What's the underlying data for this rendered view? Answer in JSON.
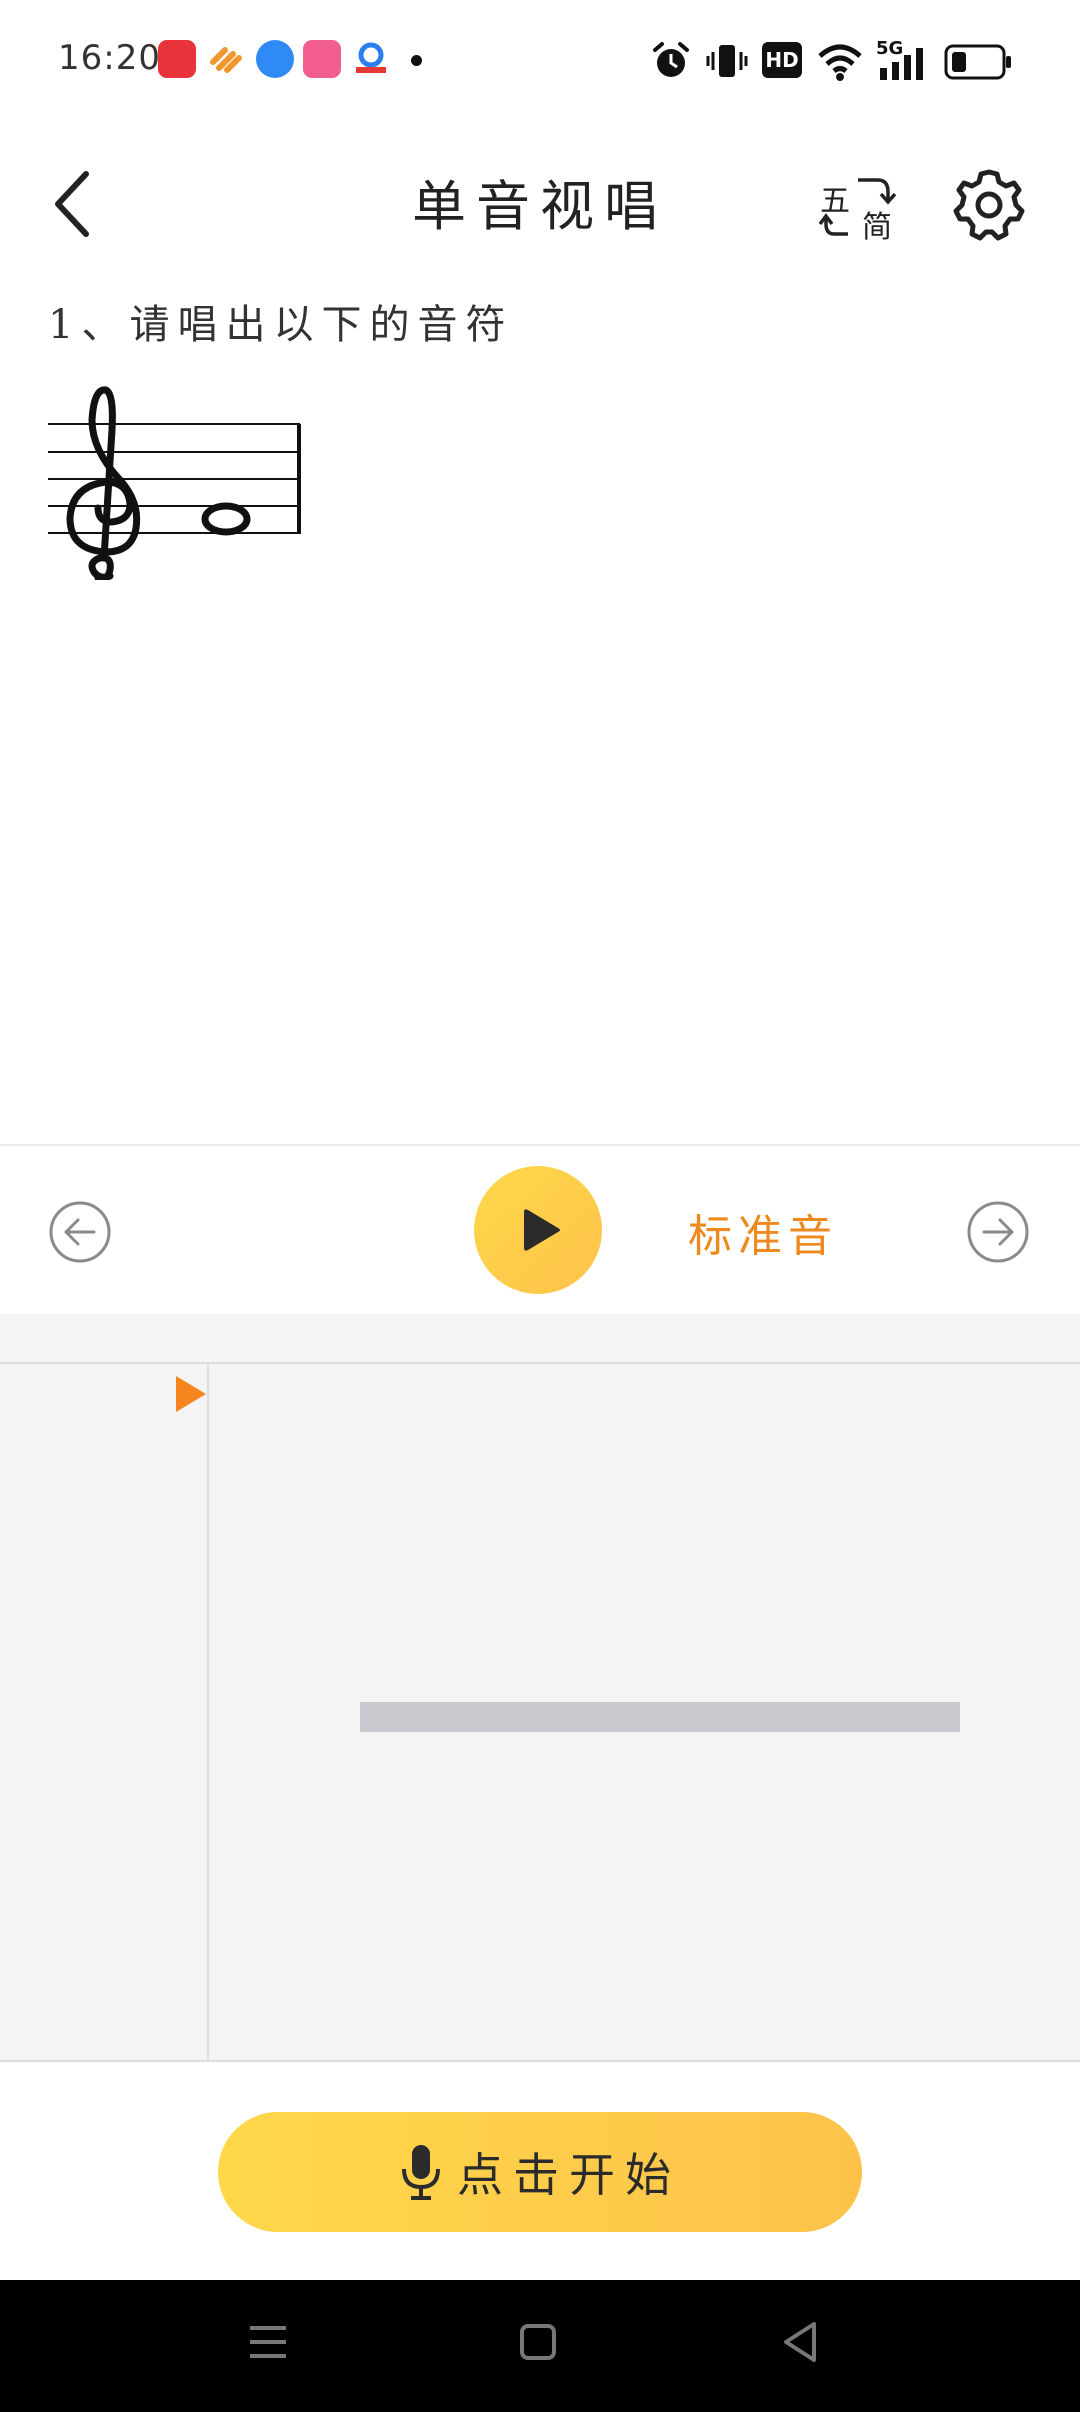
{
  "status_bar": {
    "time": "16:20",
    "network": "5G",
    "hd": "HD"
  },
  "header": {
    "title": "单音视唱",
    "switch_top": "五",
    "switch_bottom": "简"
  },
  "question": {
    "text": "1、请唱出以下的音符"
  },
  "controls": {
    "standard_label": "标准音"
  },
  "start_button": {
    "label": "点击开始"
  },
  "colors": {
    "accent_yellow": "#fec94a",
    "accent_orange": "#ee8a1d",
    "panel_bg": "#f4f4f4"
  }
}
